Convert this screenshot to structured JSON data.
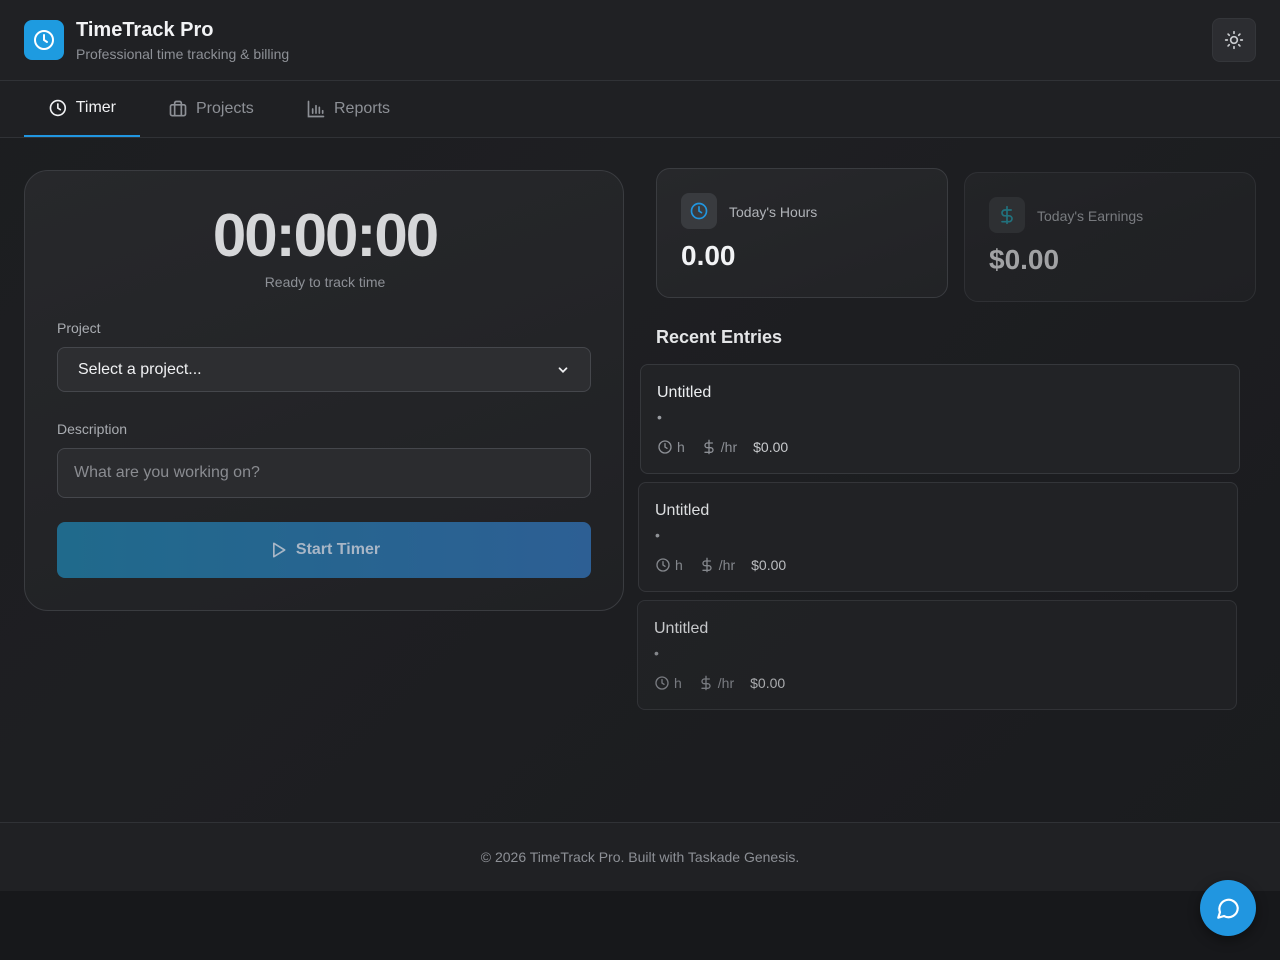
{
  "header": {
    "title": "TimeTrack Pro",
    "subtitle": "Professional time tracking & billing",
    "logo_icon": "clock-icon",
    "theme_toggle_icon": "sun-icon"
  },
  "tabs": [
    {
      "label": "Timer",
      "icon": "clock-icon",
      "active": true
    },
    {
      "label": "Projects",
      "icon": "briefcase-icon",
      "active": false
    },
    {
      "label": "Reports",
      "icon": "bar-chart-icon",
      "active": false
    }
  ],
  "timer": {
    "display": "00:00:00",
    "status": "Ready to track time",
    "project_label": "Project",
    "project_selected": "Select a project...",
    "description_label": "Description",
    "description_placeholder": "What are you working on?",
    "description_value": "",
    "start_label": "Start Timer"
  },
  "stats": {
    "hours": {
      "label": "Today's Hours",
      "value": "0.00",
      "icon": "clock-icon"
    },
    "earnings": {
      "label": "Today's Earnings",
      "value": "$0.00",
      "icon": "dollar-icon"
    }
  },
  "recent": {
    "title": "Recent Entries",
    "entries": [
      {
        "title": "Untitled",
        "bullet": "•",
        "hours": "h",
        "rate": "/hr",
        "amount": "$0.00"
      },
      {
        "title": "Untitled",
        "bullet": "•",
        "hours": "h",
        "rate": "/hr",
        "amount": "$0.00"
      },
      {
        "title": "Untitled",
        "bullet": "•",
        "hours": "h",
        "rate": "/hr",
        "amount": "$0.00"
      }
    ]
  },
  "footer": {
    "text": "© 2026 TimeTrack Pro. Built with Taskade Genesis."
  },
  "colors": {
    "accent": "#2196e0",
    "background": "#1c1d20"
  }
}
